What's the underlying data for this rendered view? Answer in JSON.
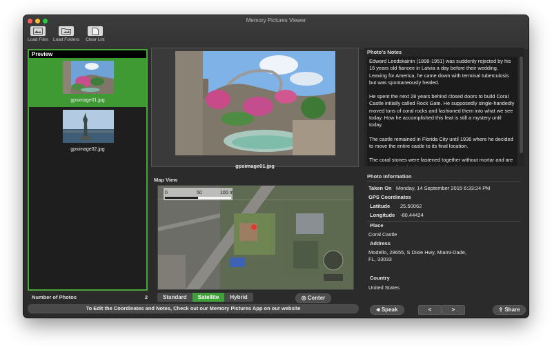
{
  "window": {
    "title": "Memory Pictures Viewer"
  },
  "toolbar": {
    "load_files": "Load Files",
    "load_folders": "Load Folders",
    "clear_list": "Clear List"
  },
  "preview": {
    "header": "Preview",
    "items": [
      {
        "label": "gpsimage01.jpg",
        "selected": true
      },
      {
        "label": "gpsimage02.jpg",
        "selected": false
      }
    ],
    "count_label": "Number of Photos",
    "count_value": "2"
  },
  "photo": {
    "caption": "gpsimage01.jpg"
  },
  "map": {
    "label": "Map View",
    "scale_labels": [
      "0",
      "50",
      "100 m"
    ],
    "modes": [
      "Standard",
      "Satellite",
      "Hybrid"
    ],
    "active_mode": "Satellite",
    "center_label": "Center"
  },
  "notes": {
    "label": "Photo's Notes",
    "paragraphs": [
      "Edward Leedskainin (1898-1951) was suddenly rejected by his 16 years old fiancee in Latvia a day before their wedding. Leaving for America, he came down with terminal tuberculosis but was spontaneously healed.",
      "He spent the next 28 years behind closed doors to build Coral Castle initially called Rock Gate. He supposedly single-handedly moved tons of coral rocks and fashioned them into what we see today. How he accomplished this feat is still a mystery until today.",
      "The castle remained in Florida City until 1936 where he decided to move the entire castle to its final location.",
      "The coral stones were fastened together without mortar and are set on top of each other using their weight to"
    ]
  },
  "info": {
    "label": "Photo Information",
    "taken_on_label": "Taken On",
    "taken_on_value": "Monday, 14 September 2015 6:33:24 PM",
    "gps_label": "GPS Coordinates",
    "lat_label": "Latitude",
    "lat_value": "25.50062",
    "lon_label": "Longitude",
    "lon_value": "-80.44424",
    "place_label": "Place",
    "place_value": "Coral Castle",
    "address_label": "Address",
    "address_value_1": "Modello, 28655, S Dixie Hwy, Miami-Dade,",
    "address_value_2": "FL, 33033",
    "country_label": "Country",
    "country_value": "United States"
  },
  "actions": {
    "speak": "Speak",
    "prev": "<",
    "next": ">",
    "share": "Share"
  },
  "footer": {
    "text": "To Edit the Coordinates and Notes, Check out our Memory Pictures App on our website"
  },
  "colors": {
    "accent": "#3f9a34",
    "window_bg": "#2b2b2b"
  }
}
